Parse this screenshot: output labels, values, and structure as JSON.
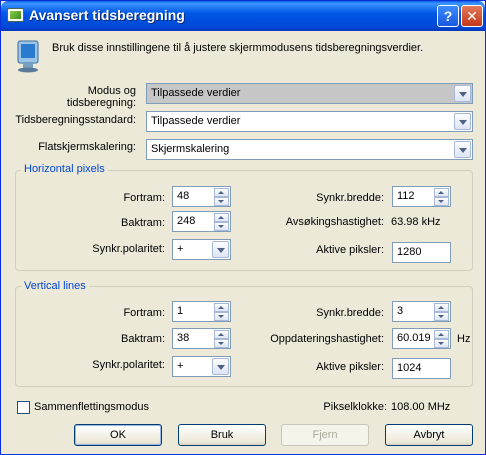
{
  "window": {
    "title": "Avansert tidsberegning",
    "help_label": "?",
    "close_label": "✕"
  },
  "intro": "Bruk disse innstillingene til å justere skjermmodusens tidsberegningsverdier.",
  "settings": {
    "mode_label_line1": "Modus og",
    "mode_label_line2": "tidsberegning:",
    "mode_value": "Tilpassede verdier",
    "standard_label": "Tidsberegningsstandard:",
    "standard_value": "Tilpassede verdier",
    "scaling_label": "Flatskjermskalering:",
    "scaling_value": "Skjermskalering"
  },
  "horizontal": {
    "title": "Horizontal pixels",
    "front_label": "Fortram:",
    "front_value": "48",
    "back_label": "Baktram:",
    "back_value": "248",
    "polarity_label": "Synkr.polaritet:",
    "polarity_value": "+",
    "sync_width_label": "Synkr.bredde:",
    "sync_width_value": "112",
    "scan_rate_label": "Avsøkingshastighet:",
    "scan_rate_value": "63.98 kHz",
    "active_label": "Aktive piksler:",
    "active_value": "1280"
  },
  "vertical": {
    "title": "Vertical lines",
    "front_label": "Fortram:",
    "front_value": "1",
    "back_label": "Baktram:",
    "back_value": "38",
    "polarity_label": "Synkr.polaritet:",
    "polarity_value": "+",
    "sync_width_label": "Synkr.bredde:",
    "sync_width_value": "3",
    "refresh_label": "Oppdateringshastighet:",
    "refresh_value": "60.019",
    "refresh_unit": "Hz",
    "active_label": "Aktive piksler:",
    "active_value": "1024"
  },
  "interlace_label": "Sammenflettingsmodus",
  "pixel_clock_label": "Pikselklokke:",
  "pixel_clock_value": "108.00 MHz",
  "buttons": {
    "ok": "OK",
    "apply": "Bruk",
    "remove": "Fjern",
    "cancel": "Avbryt"
  },
  "colors": {
    "titlebar": "#0058e6",
    "group_title": "#0046d5",
    "dialog_bg": "#ece9d8"
  },
  "icons": {
    "title": "nvidia-icon",
    "intro": "monitor-icon"
  }
}
